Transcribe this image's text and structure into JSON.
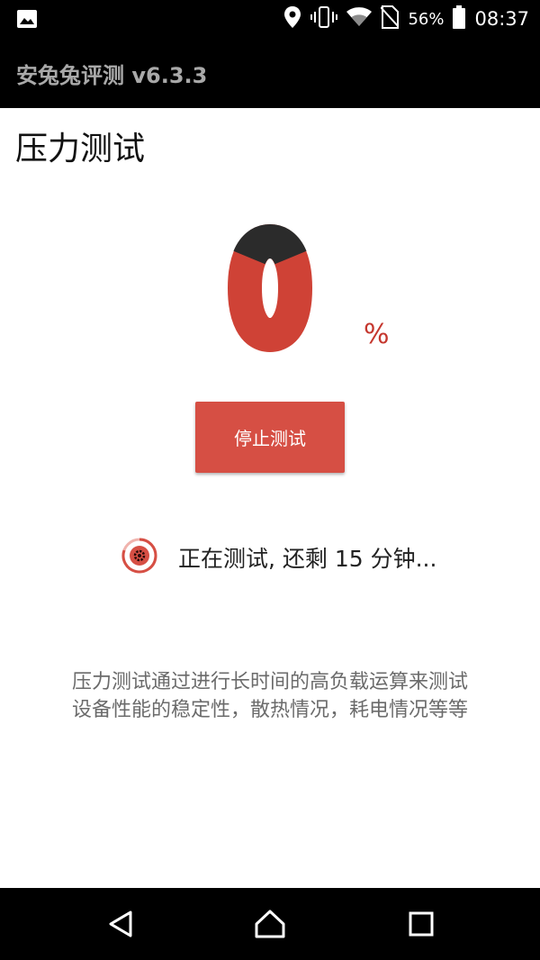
{
  "status_bar": {
    "notification_icon": "image-icon",
    "icons": [
      "location-icon",
      "vibrate-icon",
      "wifi-icon",
      "no-sim-icon",
      "battery-icon"
    ],
    "battery": "56%",
    "time": "08:37"
  },
  "app_bar": {
    "title": "安兔兔评测 v6.3.3"
  },
  "page": {
    "title": "压力测试"
  },
  "progress": {
    "value": "0",
    "unit": "%",
    "fraction": 0.0
  },
  "stop_button": {
    "label": "停止测试"
  },
  "status": {
    "icon": "spinner-icon",
    "text": "正在测试, 还剩 15 分钟..."
  },
  "description": {
    "lines": [
      "压力测试通过进行长时间的高负载运算来测试",
      "设备性能的稳定性，散热情况，耗电情况等等"
    ]
  },
  "nav_bar": {
    "buttons": [
      "back-icon",
      "home-icon",
      "recents-icon"
    ]
  },
  "colors": {
    "accent": "#d64f44",
    "progress_red": "#cf4236",
    "progress_dark": "#2b2b2b",
    "bar_bg": "#000000"
  }
}
